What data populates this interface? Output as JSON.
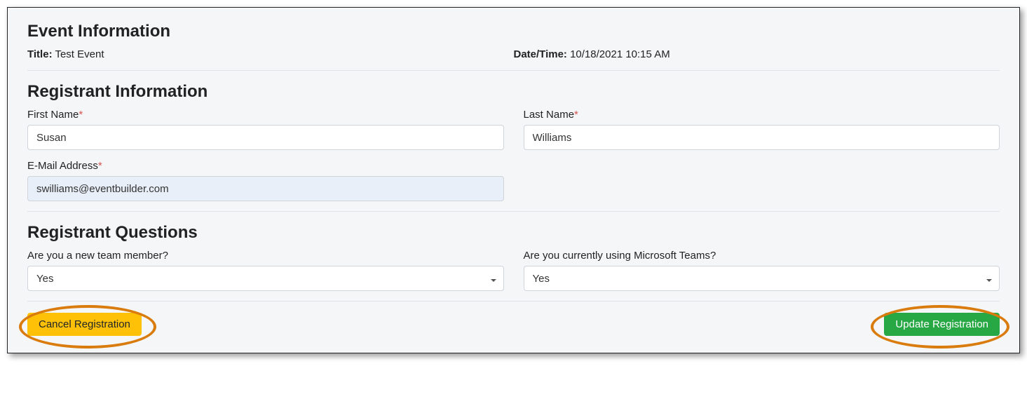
{
  "eventInfo": {
    "heading": "Event Information",
    "titleLabel": "Title:",
    "titleValue": "Test Event",
    "dateLabel": "Date/Time:",
    "dateValue": "10/18/2021 10:15 AM"
  },
  "registrantInfo": {
    "heading": "Registrant Information",
    "firstNameLabel": "First Name",
    "firstNameValue": "Susan",
    "lastNameLabel": "Last Name",
    "lastNameValue": "Williams",
    "emailLabel": "E-Mail Address",
    "emailValue": "swilliams@eventbuilder.com",
    "requiredMark": "*"
  },
  "questions": {
    "heading": "Registrant Questions",
    "q1Label": "Are you a new team member?",
    "q1Value": "Yes",
    "q2Label": "Are you currently using Microsoft Teams?",
    "q2Value": "Yes"
  },
  "buttons": {
    "cancel": "Cancel Registration",
    "update": "Update Registration"
  }
}
